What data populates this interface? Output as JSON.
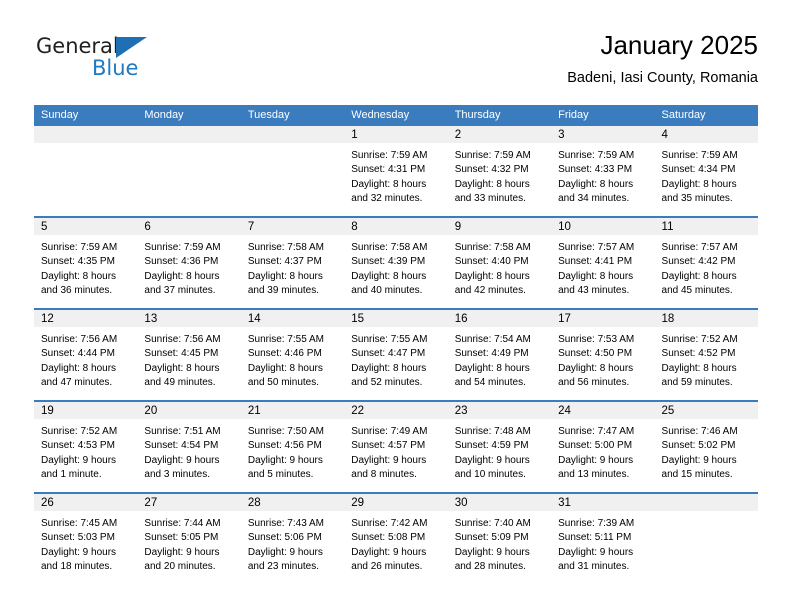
{
  "brand": {
    "name_part1": "General",
    "name_part2": "Blue",
    "triangle_color": "#1f6fb5",
    "blue_color": "#1f7ac1"
  },
  "header": {
    "title": "January 2025",
    "subtitle": "Badeni, Iasi County, Romania"
  },
  "theme": {
    "header_bar_color": "#3a7cbe",
    "day_band_color": "#f0f0f0",
    "row_rule_color": "#3a7cbe"
  },
  "weekdays": [
    "Sunday",
    "Monday",
    "Tuesday",
    "Wednesday",
    "Thursday",
    "Friday",
    "Saturday"
  ],
  "weeks": [
    [
      {
        "day": "",
        "sunrise": "",
        "sunset": "",
        "daylight1": "",
        "daylight2": ""
      },
      {
        "day": "",
        "sunrise": "",
        "sunset": "",
        "daylight1": "",
        "daylight2": ""
      },
      {
        "day": "",
        "sunrise": "",
        "sunset": "",
        "daylight1": "",
        "daylight2": ""
      },
      {
        "day": "1",
        "sunrise": "Sunrise: 7:59 AM",
        "sunset": "Sunset: 4:31 PM",
        "daylight1": "Daylight: 8 hours",
        "daylight2": "and 32 minutes."
      },
      {
        "day": "2",
        "sunrise": "Sunrise: 7:59 AM",
        "sunset": "Sunset: 4:32 PM",
        "daylight1": "Daylight: 8 hours",
        "daylight2": "and 33 minutes."
      },
      {
        "day": "3",
        "sunrise": "Sunrise: 7:59 AM",
        "sunset": "Sunset: 4:33 PM",
        "daylight1": "Daylight: 8 hours",
        "daylight2": "and 34 minutes."
      },
      {
        "day": "4",
        "sunrise": "Sunrise: 7:59 AM",
        "sunset": "Sunset: 4:34 PM",
        "daylight1": "Daylight: 8 hours",
        "daylight2": "and 35 minutes."
      }
    ],
    [
      {
        "day": "5",
        "sunrise": "Sunrise: 7:59 AM",
        "sunset": "Sunset: 4:35 PM",
        "daylight1": "Daylight: 8 hours",
        "daylight2": "and 36 minutes."
      },
      {
        "day": "6",
        "sunrise": "Sunrise: 7:59 AM",
        "sunset": "Sunset: 4:36 PM",
        "daylight1": "Daylight: 8 hours",
        "daylight2": "and 37 minutes."
      },
      {
        "day": "7",
        "sunrise": "Sunrise: 7:58 AM",
        "sunset": "Sunset: 4:37 PM",
        "daylight1": "Daylight: 8 hours",
        "daylight2": "and 39 minutes."
      },
      {
        "day": "8",
        "sunrise": "Sunrise: 7:58 AM",
        "sunset": "Sunset: 4:39 PM",
        "daylight1": "Daylight: 8 hours",
        "daylight2": "and 40 minutes."
      },
      {
        "day": "9",
        "sunrise": "Sunrise: 7:58 AM",
        "sunset": "Sunset: 4:40 PM",
        "daylight1": "Daylight: 8 hours",
        "daylight2": "and 42 minutes."
      },
      {
        "day": "10",
        "sunrise": "Sunrise: 7:57 AM",
        "sunset": "Sunset: 4:41 PM",
        "daylight1": "Daylight: 8 hours",
        "daylight2": "and 43 minutes."
      },
      {
        "day": "11",
        "sunrise": "Sunrise: 7:57 AM",
        "sunset": "Sunset: 4:42 PM",
        "daylight1": "Daylight: 8 hours",
        "daylight2": "and 45 minutes."
      }
    ],
    [
      {
        "day": "12",
        "sunrise": "Sunrise: 7:56 AM",
        "sunset": "Sunset: 4:44 PM",
        "daylight1": "Daylight: 8 hours",
        "daylight2": "and 47 minutes."
      },
      {
        "day": "13",
        "sunrise": "Sunrise: 7:56 AM",
        "sunset": "Sunset: 4:45 PM",
        "daylight1": "Daylight: 8 hours",
        "daylight2": "and 49 minutes."
      },
      {
        "day": "14",
        "sunrise": "Sunrise: 7:55 AM",
        "sunset": "Sunset: 4:46 PM",
        "daylight1": "Daylight: 8 hours",
        "daylight2": "and 50 minutes."
      },
      {
        "day": "15",
        "sunrise": "Sunrise: 7:55 AM",
        "sunset": "Sunset: 4:47 PM",
        "daylight1": "Daylight: 8 hours",
        "daylight2": "and 52 minutes."
      },
      {
        "day": "16",
        "sunrise": "Sunrise: 7:54 AM",
        "sunset": "Sunset: 4:49 PM",
        "daylight1": "Daylight: 8 hours",
        "daylight2": "and 54 minutes."
      },
      {
        "day": "17",
        "sunrise": "Sunrise: 7:53 AM",
        "sunset": "Sunset: 4:50 PM",
        "daylight1": "Daylight: 8 hours",
        "daylight2": "and 56 minutes."
      },
      {
        "day": "18",
        "sunrise": "Sunrise: 7:52 AM",
        "sunset": "Sunset: 4:52 PM",
        "daylight1": "Daylight: 8 hours",
        "daylight2": "and 59 minutes."
      }
    ],
    [
      {
        "day": "19",
        "sunrise": "Sunrise: 7:52 AM",
        "sunset": "Sunset: 4:53 PM",
        "daylight1": "Daylight: 9 hours",
        "daylight2": "and 1 minute."
      },
      {
        "day": "20",
        "sunrise": "Sunrise: 7:51 AM",
        "sunset": "Sunset: 4:54 PM",
        "daylight1": "Daylight: 9 hours",
        "daylight2": "and 3 minutes."
      },
      {
        "day": "21",
        "sunrise": "Sunrise: 7:50 AM",
        "sunset": "Sunset: 4:56 PM",
        "daylight1": "Daylight: 9 hours",
        "daylight2": "and 5 minutes."
      },
      {
        "day": "22",
        "sunrise": "Sunrise: 7:49 AM",
        "sunset": "Sunset: 4:57 PM",
        "daylight1": "Daylight: 9 hours",
        "daylight2": "and 8 minutes."
      },
      {
        "day": "23",
        "sunrise": "Sunrise: 7:48 AM",
        "sunset": "Sunset: 4:59 PM",
        "daylight1": "Daylight: 9 hours",
        "daylight2": "and 10 minutes."
      },
      {
        "day": "24",
        "sunrise": "Sunrise: 7:47 AM",
        "sunset": "Sunset: 5:00 PM",
        "daylight1": "Daylight: 9 hours",
        "daylight2": "and 13 minutes."
      },
      {
        "day": "25",
        "sunrise": "Sunrise: 7:46 AM",
        "sunset": "Sunset: 5:02 PM",
        "daylight1": "Daylight: 9 hours",
        "daylight2": "and 15 minutes."
      }
    ],
    [
      {
        "day": "26",
        "sunrise": "Sunrise: 7:45 AM",
        "sunset": "Sunset: 5:03 PM",
        "daylight1": "Daylight: 9 hours",
        "daylight2": "and 18 minutes."
      },
      {
        "day": "27",
        "sunrise": "Sunrise: 7:44 AM",
        "sunset": "Sunset: 5:05 PM",
        "daylight1": "Daylight: 9 hours",
        "daylight2": "and 20 minutes."
      },
      {
        "day": "28",
        "sunrise": "Sunrise: 7:43 AM",
        "sunset": "Sunset: 5:06 PM",
        "daylight1": "Daylight: 9 hours",
        "daylight2": "and 23 minutes."
      },
      {
        "day": "29",
        "sunrise": "Sunrise: 7:42 AM",
        "sunset": "Sunset: 5:08 PM",
        "daylight1": "Daylight: 9 hours",
        "daylight2": "and 26 minutes."
      },
      {
        "day": "30",
        "sunrise": "Sunrise: 7:40 AM",
        "sunset": "Sunset: 5:09 PM",
        "daylight1": "Daylight: 9 hours",
        "daylight2": "and 28 minutes."
      },
      {
        "day": "31",
        "sunrise": "Sunrise: 7:39 AM",
        "sunset": "Sunset: 5:11 PM",
        "daylight1": "Daylight: 9 hours",
        "daylight2": "and 31 minutes."
      },
      {
        "day": "",
        "sunrise": "",
        "sunset": "",
        "daylight1": "",
        "daylight2": ""
      }
    ]
  ]
}
